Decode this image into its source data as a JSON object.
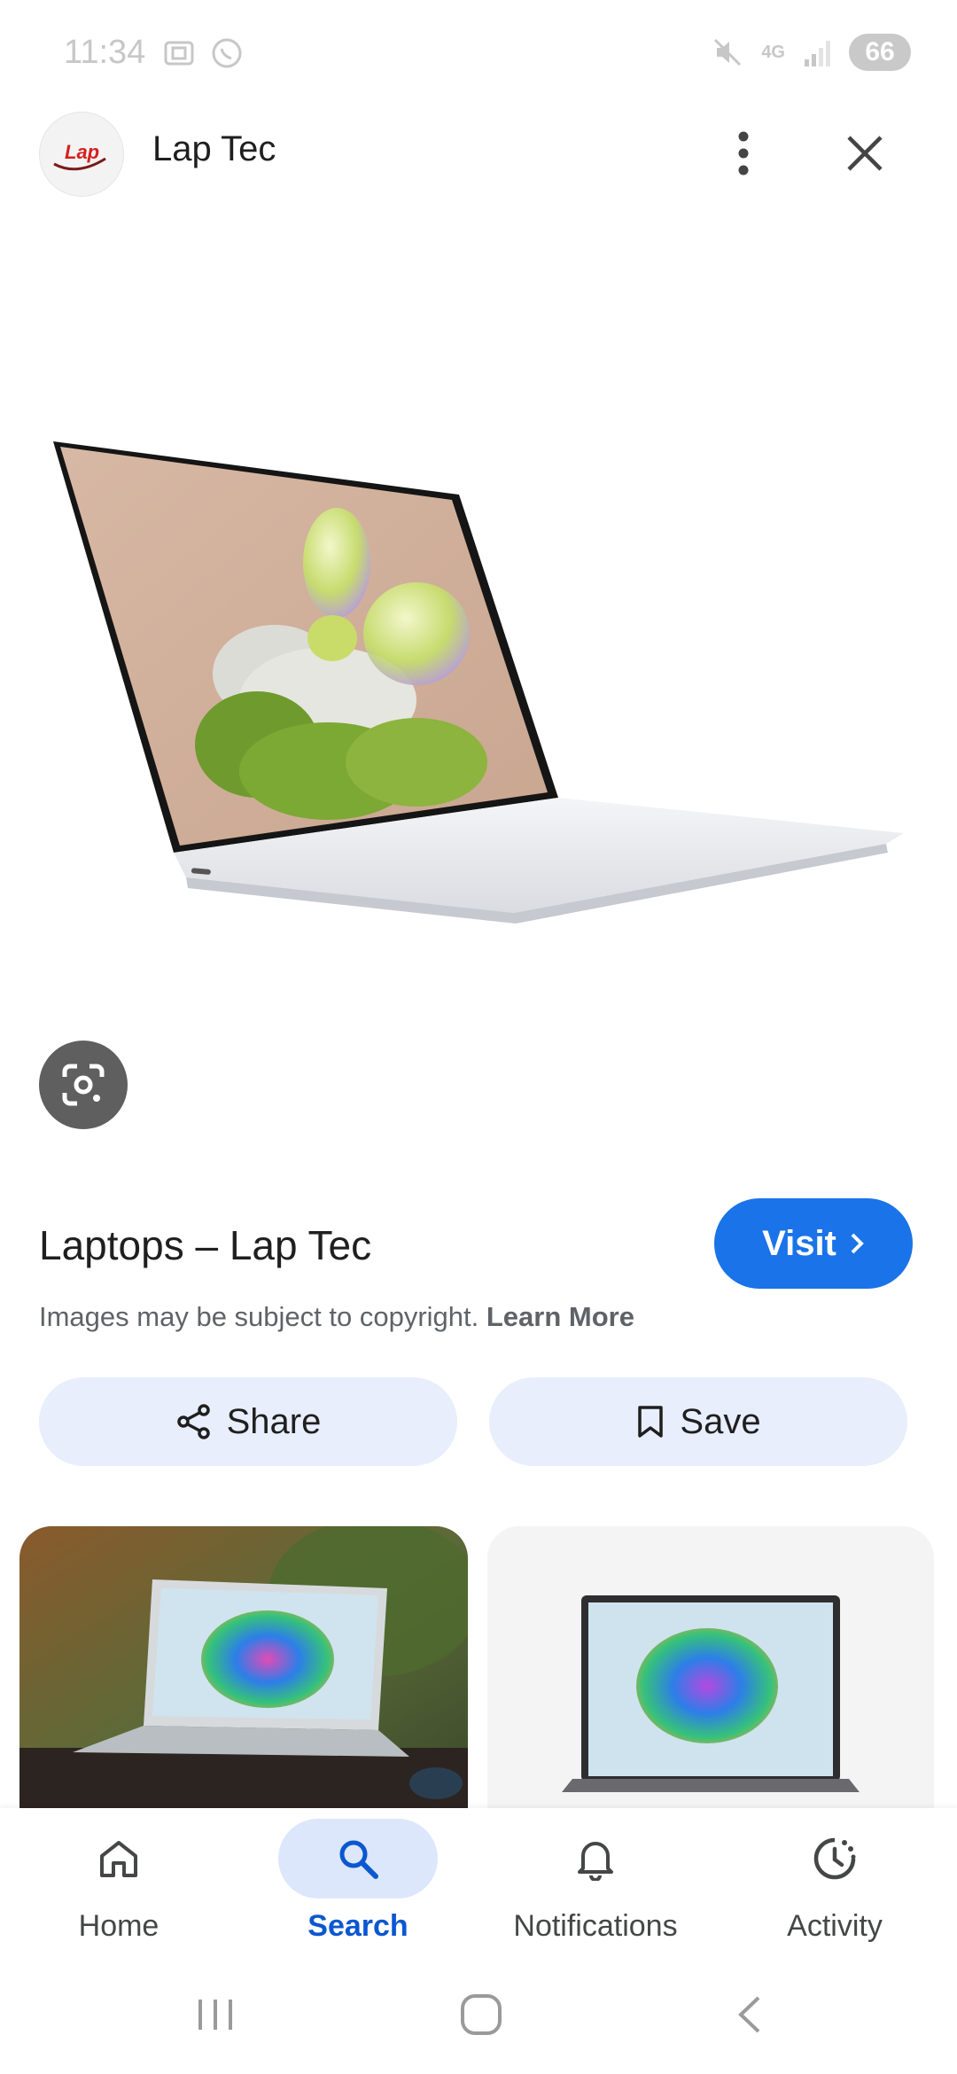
{
  "status_bar": {
    "time": "11:34",
    "network": "4G",
    "battery": "66"
  },
  "header": {
    "site_name": "Lap Tec",
    "logo_text": "Lap"
  },
  "result": {
    "title": "Laptops – Lap Tec",
    "visit_label": "Visit",
    "copyright_text": "Images may be subject to copyright.",
    "learn_more": "Learn More"
  },
  "actions": {
    "share_label": "Share",
    "save_label": "Save"
  },
  "bottom_nav": {
    "items": [
      {
        "label": "Home",
        "icon": "home-icon",
        "active": false
      },
      {
        "label": "Search",
        "icon": "search-icon",
        "active": true
      },
      {
        "label": "Notifications",
        "icon": "bell-icon",
        "active": false
      },
      {
        "label": "Activity",
        "icon": "activity-icon",
        "active": false
      }
    ]
  },
  "colors": {
    "accent": "#1a73e8",
    "active_nav": "#0b57d0",
    "chip_bg": "#e8eefc"
  }
}
